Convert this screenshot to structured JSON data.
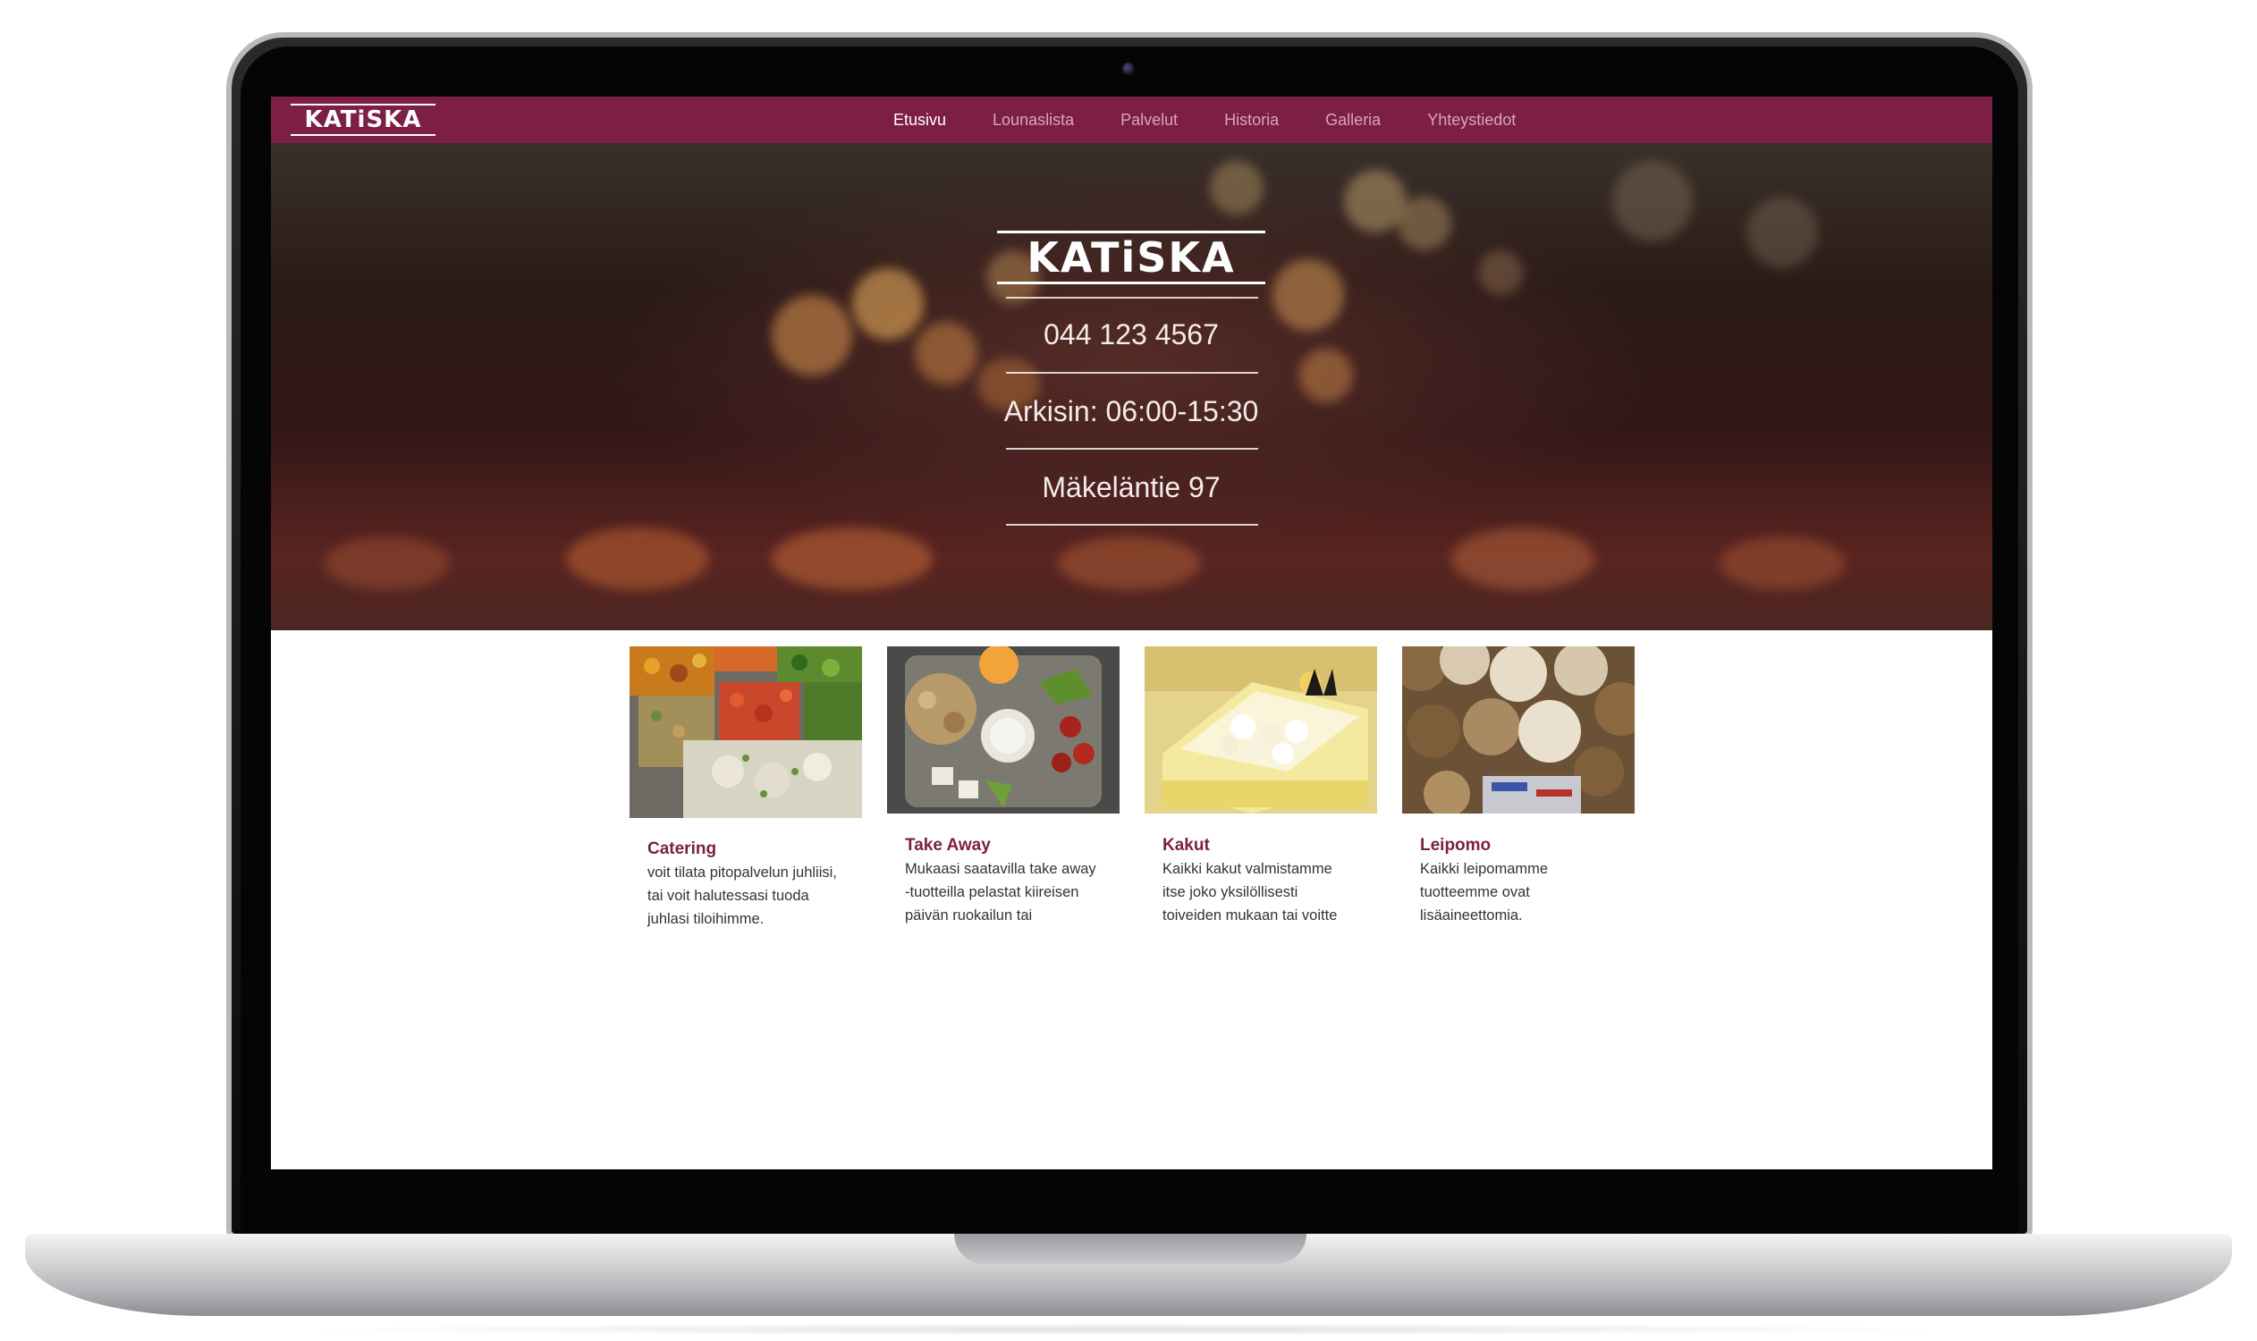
{
  "site": {
    "logo_text": "KATiSKA",
    "brand_color": "#7d1f44"
  },
  "nav": {
    "items": [
      {
        "label": "Etusivu",
        "active": true
      },
      {
        "label": "Lounaslista",
        "active": false
      },
      {
        "label": "Palvelut",
        "active": false
      },
      {
        "label": "Historia",
        "active": false
      },
      {
        "label": "Galleria",
        "active": false
      },
      {
        "label": "Yhteystiedot",
        "active": false
      }
    ]
  },
  "hero": {
    "logo_text": "KATiSKA",
    "phone": "044 123 4567",
    "hours": "Arkisin: 06:00-15:30",
    "address": "Mäkeläntie 97"
  },
  "services": [
    {
      "title": "Catering",
      "text": "voit tilata pitopalvelun juhliisi, tai voit halutessasi tuoda juhlasi tiloihimme.",
      "image_icon": "salad-trays-image"
    },
    {
      "title": "Take Away",
      "text": "Mukaasi saatavilla take away -tuotteilla pelastat kiireisen päivän ruokailun tai",
      "image_icon": "take-away-meal-image"
    },
    {
      "title": "Kakut",
      "text": "Kaikki kakut valmistamme itse joko yksilöllisesti toiveiden mukaan tai voitte",
      "image_icon": "cake-image"
    },
    {
      "title": "Leipomo",
      "text": "Kaikki leipomamme tuotteemme ovat lisäaineettomia.",
      "image_icon": "bread-rolls-image"
    }
  ]
}
